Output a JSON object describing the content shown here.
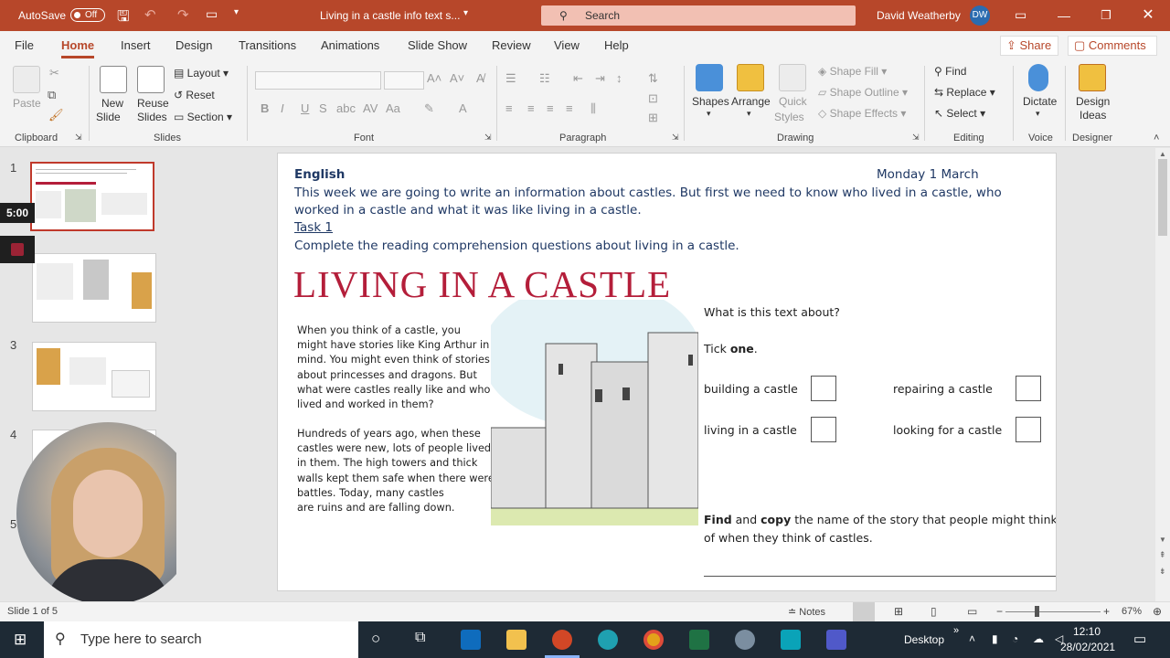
{
  "titlebar": {
    "autosave": "AutoSave",
    "toggle": "Off",
    "doc_title": "Living in a castle info text s...",
    "search": "Search",
    "user": "David Weatherby",
    "initials": "DW"
  },
  "menu": [
    "File",
    "Home",
    "Insert",
    "Design",
    "Transitions",
    "Animations",
    "Slide Show",
    "Review",
    "View",
    "Help"
  ],
  "share": "Share",
  "comments": "Comments",
  "ribbon": {
    "clipboard": {
      "paste": "Paste",
      "group": "Clipboard"
    },
    "slides": {
      "new_slide": "New",
      "new_slide2": "Slide",
      "reuse": "Reuse",
      "reuse2": "Slides",
      "layout": "Layout",
      "reset": "Reset",
      "section": "Section",
      "group": "Slides"
    },
    "font": {
      "group": "Font",
      "bold": "B",
      "italic": "I",
      "underline": "U",
      "strike": "S"
    },
    "paragraph": {
      "group": "Paragraph"
    },
    "drawing": {
      "shapes": "Shapes",
      "arrange": "Arrange",
      "quick": "Quick",
      "styles": "Styles",
      "fill": "Shape Fill",
      "outline": "Shape Outline",
      "effects": "Shape Effects",
      "group": "Drawing"
    },
    "editing": {
      "find": "Find",
      "replace": "Replace",
      "select": "Select",
      "group": "Editing"
    },
    "voice": {
      "dictate": "Dictate",
      "group": "Voice"
    },
    "designer": {
      "ideas": "Design",
      "ideas2": "Ideas",
      "group": "Designer"
    }
  },
  "thumbs": [
    "1",
    "3",
    "4",
    "5"
  ],
  "timer": "5:00",
  "slide": {
    "subject": "English",
    "date": "Monday 1 March",
    "intro1": "This week we are going to write an information about castles. But first we need to know who lived in a castle, who",
    "intro2": "worked in a castle and what it was like living in a castle.",
    "task": "Task 1",
    "instruction": "Complete the reading comprehension questions about living in a castle.",
    "title": "LIVING IN A CASTLE",
    "para1": "When you think of a castle, you\nmight have stories like King Arthur in\nmind. You might even think of stories\nabout princesses and dragons. But\nwhat were castles really like and who\nlived and worked in them?",
    "para2": "Hundreds of years ago, when these\ncastles were new, lots of people lived\nin them. The high towers and thick\nwalls kept them safe when there were\nbattles. Today, many castles\nare ruins and are falling down.",
    "question": "What is this text about?",
    "tick_pre": "Tick ",
    "tick_bold": "one",
    "tick_post": ".",
    "options": [
      "building a castle",
      "repairing a castle",
      "living in a castle",
      "looking for a castle"
    ],
    "find_bold": "Find",
    "find_and": " and ",
    "copy_bold": "copy",
    "find_rest": " the name of the story that people might think",
    "find_line2": "of when they think of castles."
  },
  "status": {
    "slide": "Slide 1 of 5",
    "notes": "Notes",
    "zoom": "67%"
  },
  "taskbar": {
    "search": "Type here to search",
    "desktop": "Desktop",
    "time": "12:10",
    "date": "28/02/2021"
  }
}
